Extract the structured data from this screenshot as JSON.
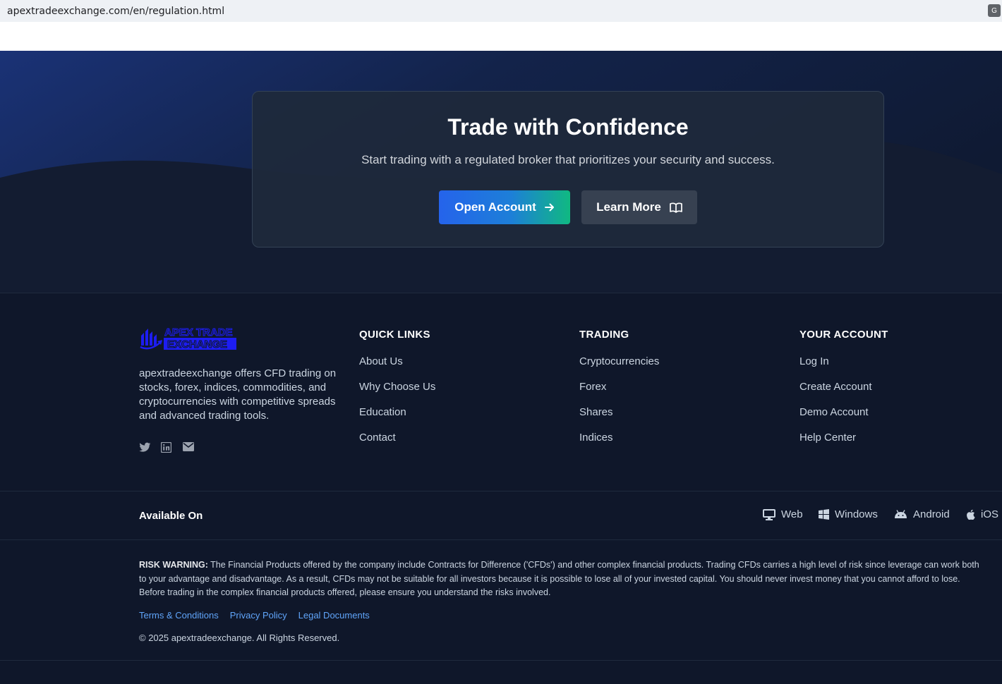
{
  "browser": {
    "url": "apextradeexchange.com/en/regulation.html"
  },
  "cta": {
    "title": "Trade with Confidence",
    "subtitle": "Start trading with a regulated broker that prioritizes your security and success.",
    "open_account_label": "Open Account",
    "learn_more_label": "Learn More"
  },
  "footer": {
    "brand": {
      "logo_line1": "APEX TRADE",
      "logo_line2": "EXCHANGE",
      "description": "apextradeexchange offers CFD trading on stocks, forex, indices, commodities, and cryptocurrencies with competitive spreads and advanced trading tools."
    },
    "social": [
      "twitter-icon",
      "linkedin-icon",
      "envelope-icon"
    ],
    "quick_links": {
      "heading": "QUICK LINKS",
      "items": [
        "About Us",
        "Why Choose Us",
        "Education",
        "Contact"
      ]
    },
    "trading": {
      "heading": "TRADING",
      "items": [
        "Cryptocurrencies",
        "Forex",
        "Shares",
        "Indices"
      ]
    },
    "your_account": {
      "heading": "YOUR ACCOUNT",
      "items": [
        "Log In",
        "Create Account",
        "Demo Account",
        "Help Center"
      ]
    }
  },
  "available": {
    "title": "Available On",
    "platforms": [
      {
        "label": "Web",
        "icon": "desktop-icon"
      },
      {
        "label": "Windows",
        "icon": "windows-icon"
      },
      {
        "label": "Android",
        "icon": "android-icon"
      },
      {
        "label": "iOS",
        "icon": "apple-icon"
      }
    ]
  },
  "legal": {
    "risk_label": "RISK WARNING:",
    "risk_text": "The Financial Products offered by the company include Contracts for Difference ('CFDs') and other complex financial products. Trading CFDs carries a high level of risk since leverage can work both to your advantage and disadvantage. As a result, CFDs may not be suitable for all investors because it is possible to lose all of your invested capital. You should never invest money that you cannot afford to lose. Before trading in the complex financial products offered, please ensure you understand the risks involved.",
    "links": [
      "Terms & Conditions",
      "Privacy Policy",
      "Legal Documents"
    ],
    "copyright": "© 2025 apextradeexchange. All Rights Reserved."
  },
  "colors": {
    "background": "#0f172a",
    "accent_blue": "#2563eb",
    "accent_green": "#10b981",
    "link": "#60a5fa",
    "logo_blue": "#1d1df2"
  }
}
